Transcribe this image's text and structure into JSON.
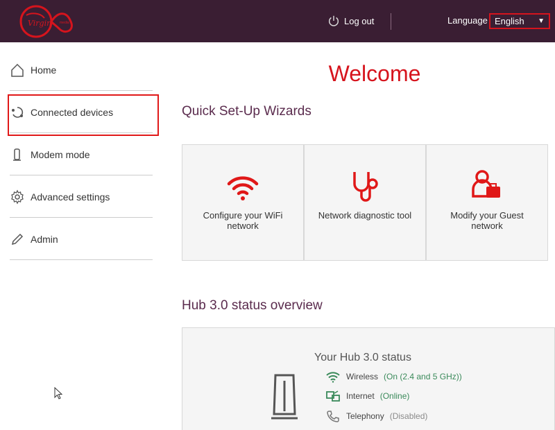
{
  "header": {
    "logout_label": "Log out",
    "language_label": "Language",
    "language_selected": "English"
  },
  "sidebar": {
    "items": [
      {
        "label": "Home",
        "icon": "home-icon"
      },
      {
        "label": "Connected devices",
        "icon": "connected-devices-icon"
      },
      {
        "label": "Modem mode",
        "icon": "modem-icon"
      },
      {
        "label": "Advanced settings",
        "icon": "gear-icon"
      },
      {
        "label": "Admin",
        "icon": "pencil-icon"
      }
    ]
  },
  "main": {
    "welcome": "Welcome",
    "wizards_title": "Quick Set-Up Wizards",
    "wizards": [
      {
        "label": "Configure your WiFi network",
        "icon": "wifi-icon"
      },
      {
        "label": "Network diagnostic tool",
        "icon": "stethoscope-icon"
      },
      {
        "label": "Modify your Guest network",
        "icon": "guest-user-icon"
      }
    ],
    "status_title": "Hub 3.0 status overview",
    "status_card_title": "Your Hub 3.0 status",
    "status_rows": [
      {
        "name": "Wireless",
        "state": "(On (2.4 and 5 GHz))",
        "icon": "wifi-status-icon"
      },
      {
        "name": "Internet",
        "state": "(Online)",
        "icon": "internet-status-icon"
      },
      {
        "name": "Telephony",
        "state": "(Disabled)",
        "icon": "phone-icon"
      }
    ]
  },
  "colors": {
    "header_bg": "#3a1e33",
    "brand_red": "#d6141d",
    "title_purple": "#5a2b4d",
    "status_green": "#3a8a5a"
  }
}
